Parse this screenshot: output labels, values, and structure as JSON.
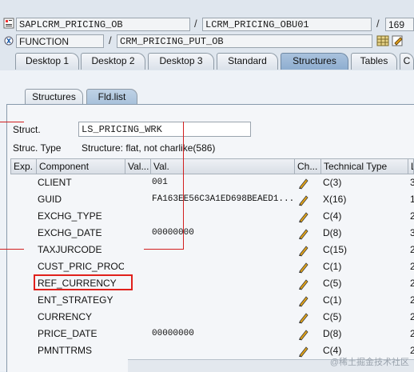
{
  "header": {
    "program": "SAPLCRM_PRICING_OB",
    "include": "LCRM_PRICING_OBU01",
    "line": "169",
    "type": "FUNCTION",
    "object": "CRM_PRICING_PUT_OB"
  },
  "tabs": [
    "Desktop 1",
    "Desktop 2",
    "Desktop 3",
    "Standard",
    "Structures",
    "Tables",
    "C"
  ],
  "active_tab": "Structures",
  "subtabs": [
    "Structures",
    "Fld.list"
  ],
  "active_subtab": "Fld.list",
  "struct": {
    "label": "Struct.",
    "value": "LS_PRICING_WRK",
    "type_label": "Struc. Type",
    "type_value": "Structure: flat, not charlike(586)"
  },
  "columns": [
    "Exp.",
    "Component",
    "Val...",
    "Val.",
    "Ch...",
    "Technical Type",
    "L"
  ],
  "rows": [
    {
      "component": "CLIENT",
      "value": "001",
      "tech": "C(3)",
      "len": "3"
    },
    {
      "component": "GUID",
      "value": "FA163EE56C3A1ED698BEAED1...",
      "tech": "X(16)",
      "len": "1"
    },
    {
      "component": "EXCHG_TYPE",
      "value": "",
      "tech": "C(4)",
      "len": "2"
    },
    {
      "component": "EXCHG_DATE",
      "value": "00000000",
      "tech": "D(8)",
      "len": "3"
    },
    {
      "component": "TAXJURCODE",
      "value": "",
      "tech": "C(15)",
      "len": "2"
    },
    {
      "component": "CUST_PRIC_PROC",
      "value": "",
      "tech": "C(1)",
      "len": "2"
    },
    {
      "component": "REF_CURRENCY",
      "value": "",
      "tech": "C(5)",
      "len": "2"
    },
    {
      "component": "ENT_STRATEGY",
      "value": "",
      "tech": "C(1)",
      "len": "2"
    },
    {
      "component": "CURRENCY",
      "value": "",
      "tech": "C(5)",
      "len": "2"
    },
    {
      "component": "PRICE_DATE",
      "value": "00000000",
      "tech": "D(8)",
      "len": "2"
    },
    {
      "component": "PMNTTRMS",
      "value": "",
      "tech": "C(4)",
      "len": "2"
    }
  ],
  "highlighted_row": "REF_CURRENCY",
  "watermark": "@稀土掘金技术社区",
  "colors": {
    "highlight": "#e0201c",
    "active_tab": "#8eaed0"
  }
}
